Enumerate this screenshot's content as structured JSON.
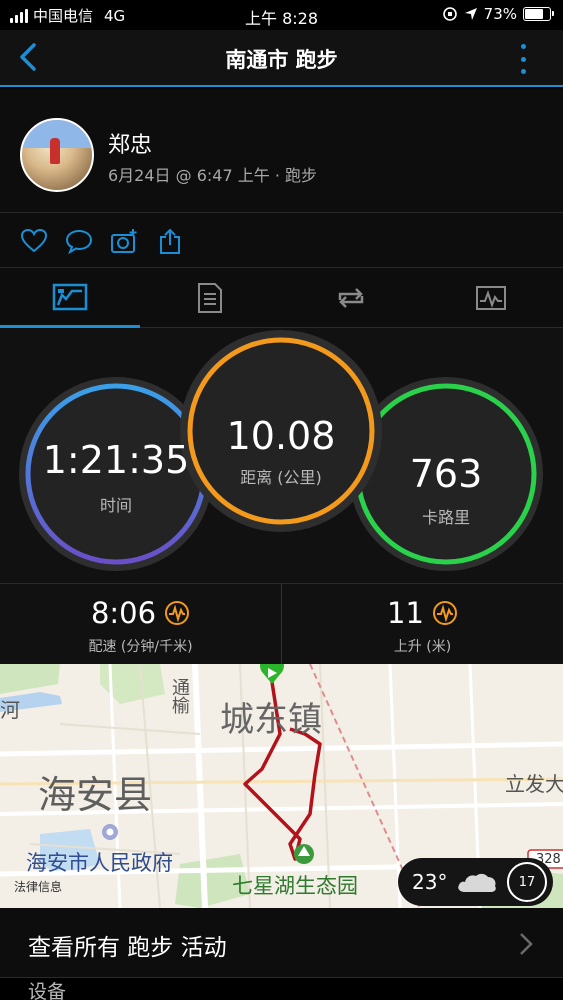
{
  "status_bar": {
    "carrier": "中国电信",
    "network": "4G",
    "time": "上午 8:28",
    "battery": "73%",
    "battery_level": 0.73
  },
  "header": {
    "title": "南通市 跑步"
  },
  "profile": {
    "name": "郑忠",
    "meta": "6月24日 @ 6:47 上午 · 跑步"
  },
  "stats": {
    "time_value": "1:21:35",
    "time_label": "时间",
    "distance_value": "10.08",
    "distance_label": "距离 (公里)",
    "calories_value": "763",
    "calories_label": "卡路里"
  },
  "pace": {
    "pace_value": "8:06",
    "pace_label": "配速 (分钟/千米)",
    "ascent_value": "11",
    "ascent_label": "上升 (米)"
  },
  "map": {
    "labels": {
      "river": "河",
      "road": "通榆",
      "town": "城东镇",
      "county": "海安县",
      "east": "立发大",
      "gov": "海安市人民政府",
      "park": "七星湖生态园",
      "legal": "法律信息",
      "road_num": "328"
    },
    "weather_temp": "23°",
    "wind_speed": "17"
  },
  "footer": {
    "view_all": "查看所有 跑步 活动",
    "section": "设备"
  },
  "colors": {
    "accent": "#1b8fd6",
    "time_ring": "#5a6fd6",
    "distance_ring": "#f39a1c",
    "calories_ring": "#2ad14a",
    "pace_icon": "#f39a1c",
    "route": "#b3121b"
  }
}
